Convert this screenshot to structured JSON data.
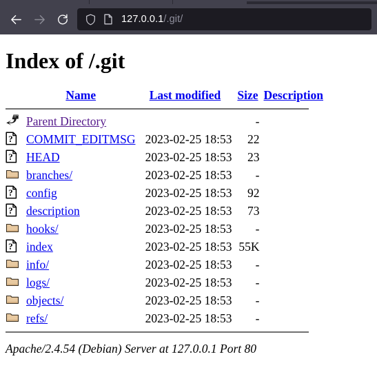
{
  "browser": {
    "back_icon": "back-arrow-icon",
    "forward_icon": "forward-arrow-icon",
    "reload_icon": "reload-icon",
    "shield_icon": "shield-icon",
    "page_icon": "page-document-icon",
    "url_host": "127.0.0.1",
    "url_path": "/.git/",
    "url_full": "127.0.0.1/.git/",
    "colors": {
      "chrome_bg": "#42414d",
      "urlbar_bg": "#1c1b22",
      "tabstrip_bg": "#42414d",
      "active_tab_bg": "#2b2a33",
      "icon_active": "#ffffff",
      "icon_disabled": "#8b8b95",
      "url_host_color": "#ffffff",
      "url_path_color": "#8f8f9d"
    }
  },
  "page": {
    "title": "Index of /.git",
    "footer": "Apache/2.4.54 (Debian) Server at 127.0.0.1 Port 80",
    "colors": {
      "link": "#0000ee",
      "visited_link": "#551a8b",
      "rule": "#707070",
      "folder_icon": "#e8c9a0",
      "background": "#ffffff",
      "text": "#000000"
    },
    "columns": [
      {
        "label": "Name",
        "key": "name"
      },
      {
        "label": "Last modified",
        "key": "modified"
      },
      {
        "label": "Size",
        "key": "size"
      },
      {
        "label": "Description",
        "key": "description"
      }
    ],
    "rows": [
      {
        "icon": "parent-directory-icon",
        "name": "Parent Directory",
        "modified": "",
        "size": "-",
        "description": "",
        "visited": true
      },
      {
        "icon": "unknown-file-icon",
        "name": "COMMIT_EDITMSG",
        "modified": "2023-02-25 18:53",
        "size": "22",
        "description": "",
        "visited": false
      },
      {
        "icon": "unknown-file-icon",
        "name": "HEAD",
        "modified": "2023-02-25 18:53",
        "size": "23",
        "description": "",
        "visited": false
      },
      {
        "icon": "folder-icon",
        "name": "branches/",
        "modified": "2023-02-25 18:53",
        "size": "-",
        "description": "",
        "visited": false
      },
      {
        "icon": "unknown-file-icon",
        "name": "config",
        "modified": "2023-02-25 18:53",
        "size": "92",
        "description": "",
        "visited": false
      },
      {
        "icon": "unknown-file-icon",
        "name": "description",
        "modified": "2023-02-25 18:53",
        "size": "73",
        "description": "",
        "visited": false
      },
      {
        "icon": "folder-icon",
        "name": "hooks/",
        "modified": "2023-02-25 18:53",
        "size": "-",
        "description": "",
        "visited": false
      },
      {
        "icon": "unknown-file-icon",
        "name": "index",
        "modified": "2023-02-25 18:53",
        "size": "55K",
        "description": "",
        "visited": false
      },
      {
        "icon": "folder-icon",
        "name": "info/",
        "modified": "2023-02-25 18:53",
        "size": "-",
        "description": "",
        "visited": false
      },
      {
        "icon": "folder-icon",
        "name": "logs/",
        "modified": "2023-02-25 18:53",
        "size": "-",
        "description": "",
        "visited": false
      },
      {
        "icon": "folder-icon",
        "name": "objects/",
        "modified": "2023-02-25 18:53",
        "size": "-",
        "description": "",
        "visited": false
      },
      {
        "icon": "folder-icon",
        "name": "refs/",
        "modified": "2023-02-25 18:53",
        "size": "-",
        "description": "",
        "visited": false
      }
    ]
  }
}
